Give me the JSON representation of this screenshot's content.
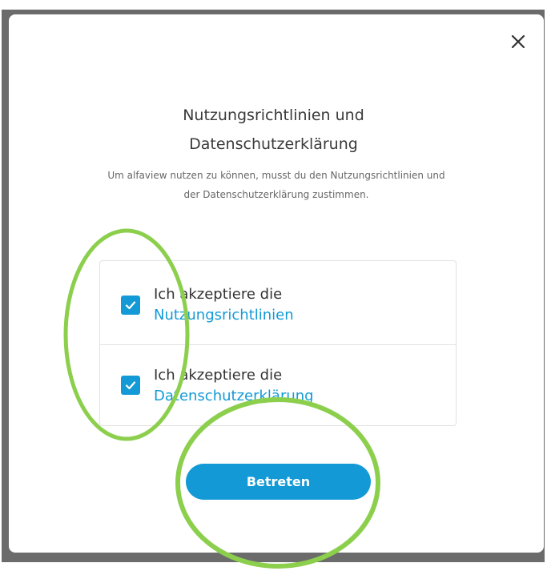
{
  "dialog": {
    "title_line1": "Nutzungsrichtlinien und",
    "title_line2": "Datenschutzerklärung",
    "description": "Um alfaview nutzen zu können, musst du den Nutzungsrichtlinien und der Datenschutzerklärung zustimmen.",
    "close_icon": "close-icon",
    "consents": [
      {
        "prefix": "Ich akzeptiere die",
        "link": "Nutzungsrichtlinien",
        "checked": true
      },
      {
        "prefix": "Ich akzeptiere die",
        "link": "Datenschutzerklärung",
        "checked": true
      }
    ],
    "submit_label": "Betreten"
  },
  "colors": {
    "accent": "#139ad6",
    "annotation": "#8ccf4d"
  }
}
